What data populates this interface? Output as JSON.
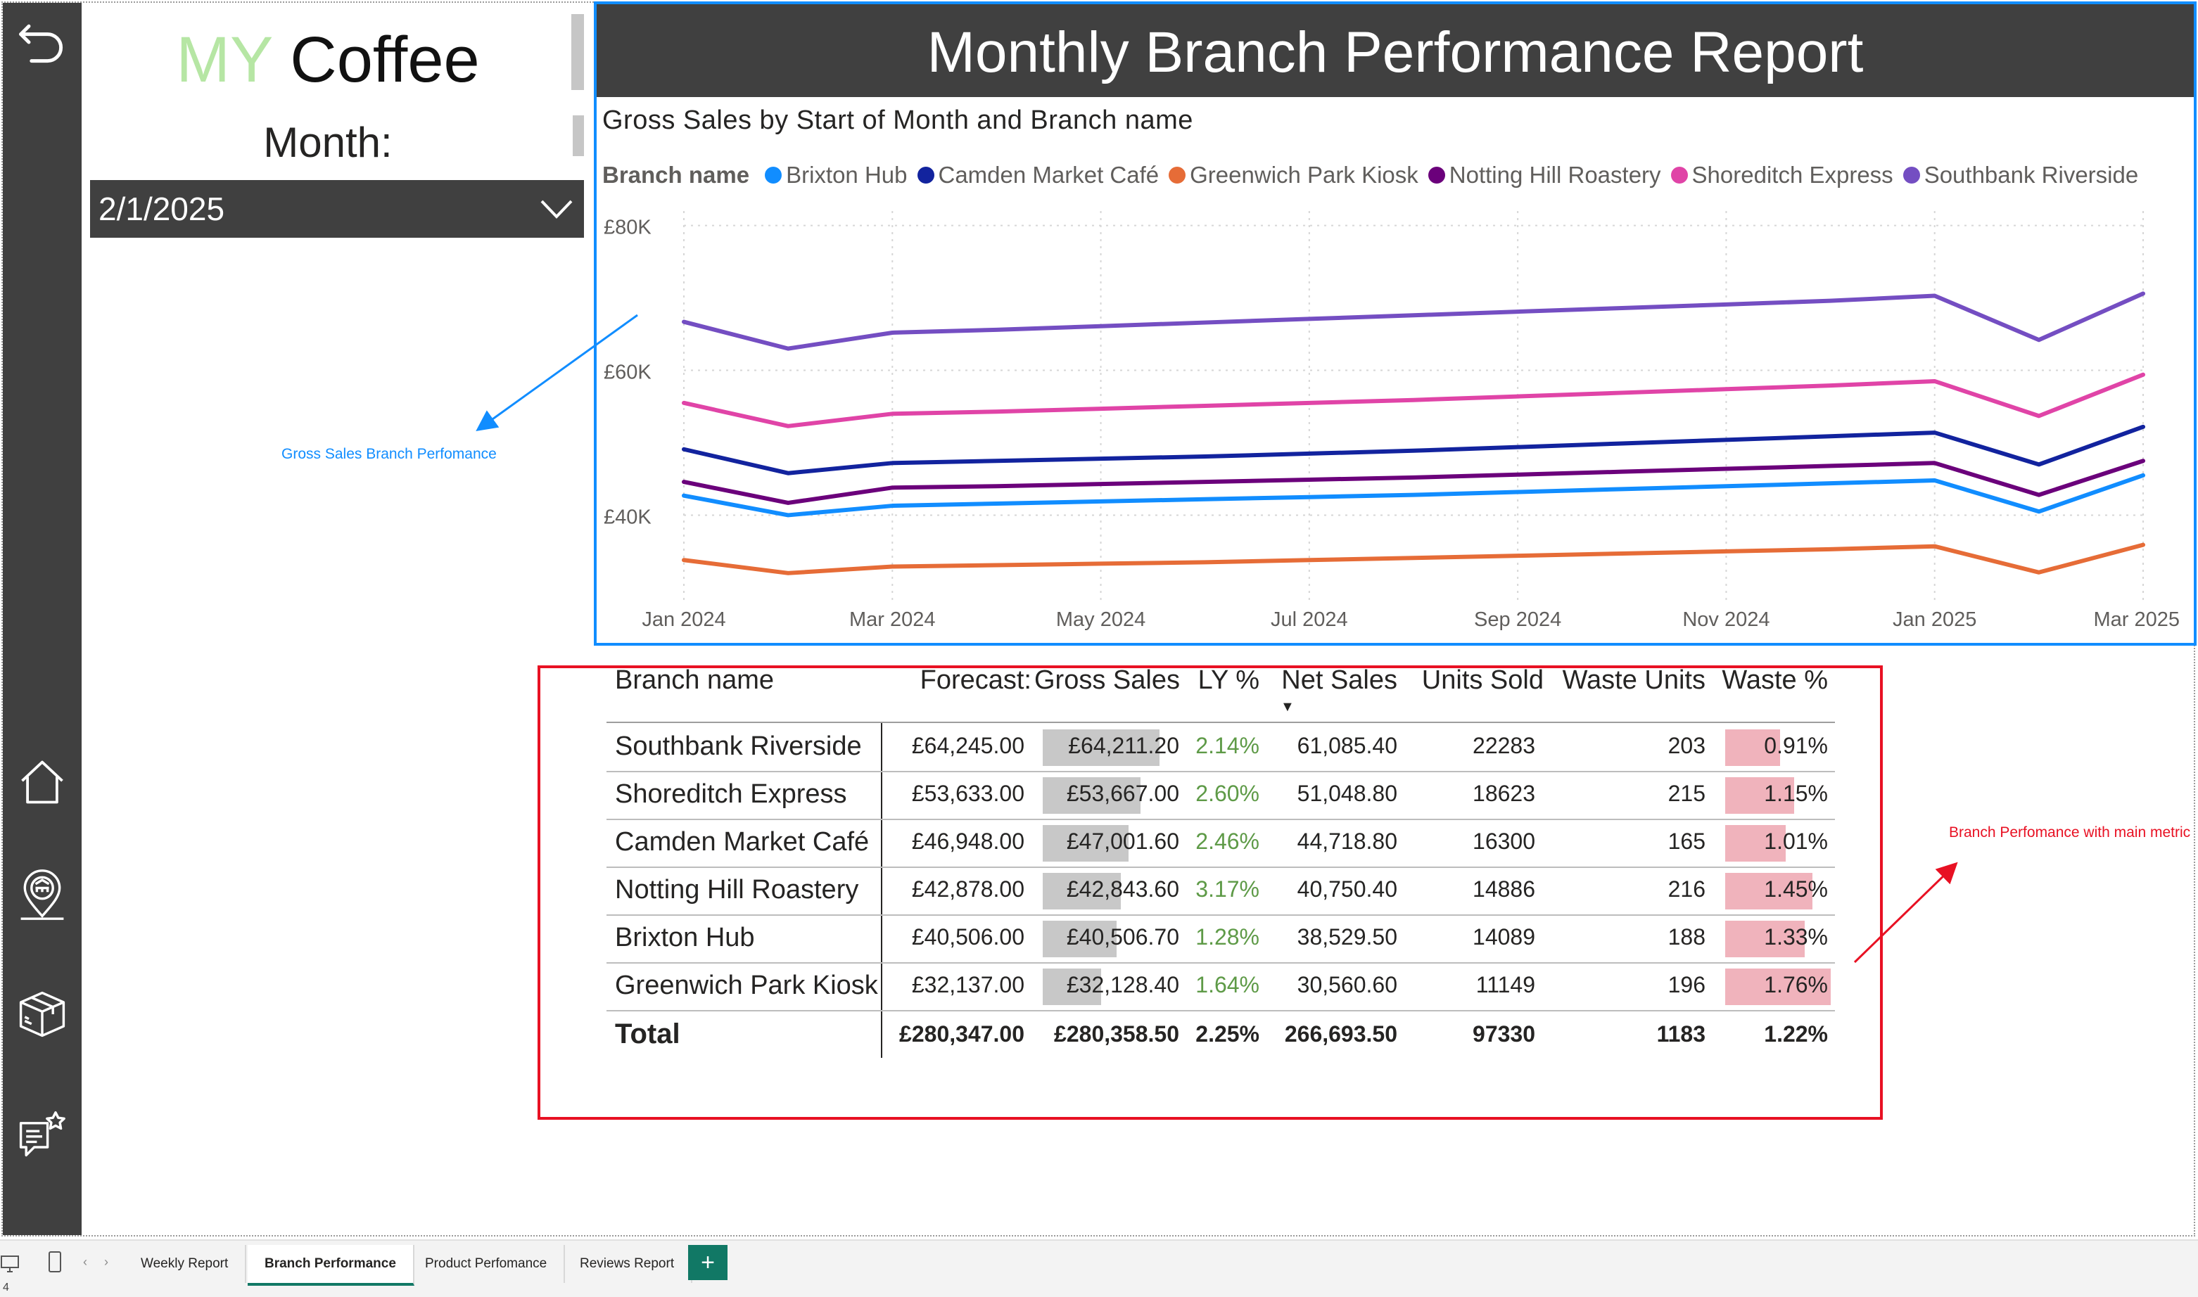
{
  "brand": {
    "my": "MY",
    "coffee": "Coffee"
  },
  "month_filter": {
    "label": "Month:",
    "value": "2/1/2025"
  },
  "report": {
    "title": "Monthly Branch Performance Report"
  },
  "colors": {
    "nav": "#404040",
    "accent_blue": "#118dff",
    "annotation_red": "#e81123",
    "positive_green": "#5e9a47",
    "waste_bar": "#f0b3bc",
    "sales_bar": "#c8c8c8"
  },
  "chart_data": {
    "type": "line",
    "title": "Gross Sales by Start of Month and Branch name",
    "legend_title": "Branch name",
    "x": [
      "2024-01",
      "2024-02",
      "2024-03",
      "2024-04",
      "2024-05",
      "2024-06",
      "2024-07",
      "2024-08",
      "2024-09",
      "2024-10",
      "2024-11",
      "2024-12",
      "2025-01",
      "2025-02",
      "2025-03"
    ],
    "x_tick_labels": [
      "Jan 2024",
      "Mar 2024",
      "May 2024",
      "Jul 2024",
      "Sep 2024",
      "Nov 2024",
      "Jan 2025",
      "Mar 2025"
    ],
    "y_tick_labels": [
      "£40K",
      "£60K",
      "£80K"
    ],
    "ylim": [
      28000,
      82000
    ],
    "grid": true,
    "legend_position": "top-left",
    "series": [
      {
        "name": "Brixton Hub",
        "color": "#118dff",
        "values": [
          42700,
          40000,
          41300,
          41600,
          41900,
          42200,
          42500,
          42800,
          43200,
          43600,
          44000,
          44400,
          44800,
          40500,
          45500
        ]
      },
      {
        "name": "Camden Market Café",
        "color": "#12239e",
        "values": [
          49100,
          45800,
          47200,
          47500,
          47800,
          48100,
          48500,
          48900,
          49400,
          49900,
          50400,
          50900,
          51400,
          47000,
          52200
        ]
      },
      {
        "name": "Greenwich Park Kiosk",
        "color": "#e66c37",
        "values": [
          33800,
          32000,
          32900,
          33100,
          33300,
          33500,
          33800,
          34100,
          34400,
          34700,
          35000,
          35300,
          35700,
          32100,
          35900
        ]
      },
      {
        "name": "Notting Hill Roastery",
        "color": "#6b007b",
        "values": [
          44600,
          41700,
          43800,
          44000,
          44300,
          44600,
          44900,
          45200,
          45600,
          46000,
          46400,
          46800,
          47200,
          42800,
          47500
        ]
      },
      {
        "name": "Shoreditch Express",
        "color": "#e044a7",
        "values": [
          55500,
          52300,
          54000,
          54300,
          54700,
          55100,
          55500,
          55900,
          56400,
          56900,
          57400,
          57900,
          58500,
          53700,
          59400
        ]
      },
      {
        "name": "Southbank Riverside",
        "color": "#744ec2",
        "values": [
          66700,
          63000,
          65200,
          65600,
          66100,
          66600,
          67100,
          67600,
          68100,
          68600,
          69100,
          69600,
          70300,
          64200,
          70600
        ]
      }
    ]
  },
  "table": {
    "columns": [
      "Branch name",
      "Forecast:",
      "Gross Sales",
      "LY %",
      "Net Sales",
      "Units Sold",
      "Waste Units",
      "Waste %"
    ],
    "rows": [
      {
        "branch": "Southbank Riverside",
        "forecast": "£64,245.00",
        "gross": "£64,211.20",
        "gross_value": 64211.2,
        "ly": "2.14%",
        "net": "61,085.40",
        "units": "22283",
        "waste_units": "203",
        "waste_pct": "0.91%",
        "waste_value": 0.91
      },
      {
        "branch": "Shoreditch Express",
        "forecast": "£53,633.00",
        "gross": "£53,667.00",
        "gross_value": 53667.0,
        "ly": "2.60%",
        "net": "51,048.80",
        "units": "18623",
        "waste_units": "215",
        "waste_pct": "1.15%",
        "waste_value": 1.15
      },
      {
        "branch": "Camden Market Café",
        "forecast": "£46,948.00",
        "gross": "£47,001.60",
        "gross_value": 47001.6,
        "ly": "2.46%",
        "net": "44,718.80",
        "units": "16300",
        "waste_units": "165",
        "waste_pct": "1.01%",
        "waste_value": 1.01
      },
      {
        "branch": "Notting Hill Roastery",
        "forecast": "£42,878.00",
        "gross": "£42,843.60",
        "gross_value": 42843.6,
        "ly": "3.17%",
        "net": "40,750.40",
        "units": "14886",
        "waste_units": "216",
        "waste_pct": "1.45%",
        "waste_value": 1.45
      },
      {
        "branch": "Brixton Hub",
        "forecast": "£40,506.00",
        "gross": "£40,506.70",
        "gross_value": 40506.7,
        "ly": "1.28%",
        "net": "38,529.50",
        "units": "14089",
        "waste_units": "188",
        "waste_pct": "1.33%",
        "waste_value": 1.33
      },
      {
        "branch": "Greenwich Park Kiosk",
        "forecast": "£32,137.00",
        "gross": "£32,128.40",
        "gross_value": 32128.4,
        "ly": "1.64%",
        "net": "30,560.60",
        "units": "11149",
        "waste_units": "196",
        "waste_pct": "1.76%",
        "waste_value": 1.76
      }
    ],
    "total": {
      "label": "Total",
      "forecast": "£280,347.00",
      "gross": "£280,358.50",
      "ly": "2.25%",
      "net": "266,693.50",
      "units": "97330",
      "waste_units": "1183",
      "waste_pct": "1.22%"
    }
  },
  "annotations": {
    "chart": "Gross Sales Branch Perfomance",
    "table": "Branch Perfomance with main metric"
  },
  "nav_icons": [
    "back-arrow-icon",
    "home-icon",
    "location-pin-icon",
    "box-icon",
    "feedback-icon"
  ],
  "tabs": [
    "Weekly Report",
    "Branch Performance",
    "Product Perfomance",
    "Reviews Report"
  ],
  "active_tab": "Branch Performance",
  "page_indicator": "4"
}
